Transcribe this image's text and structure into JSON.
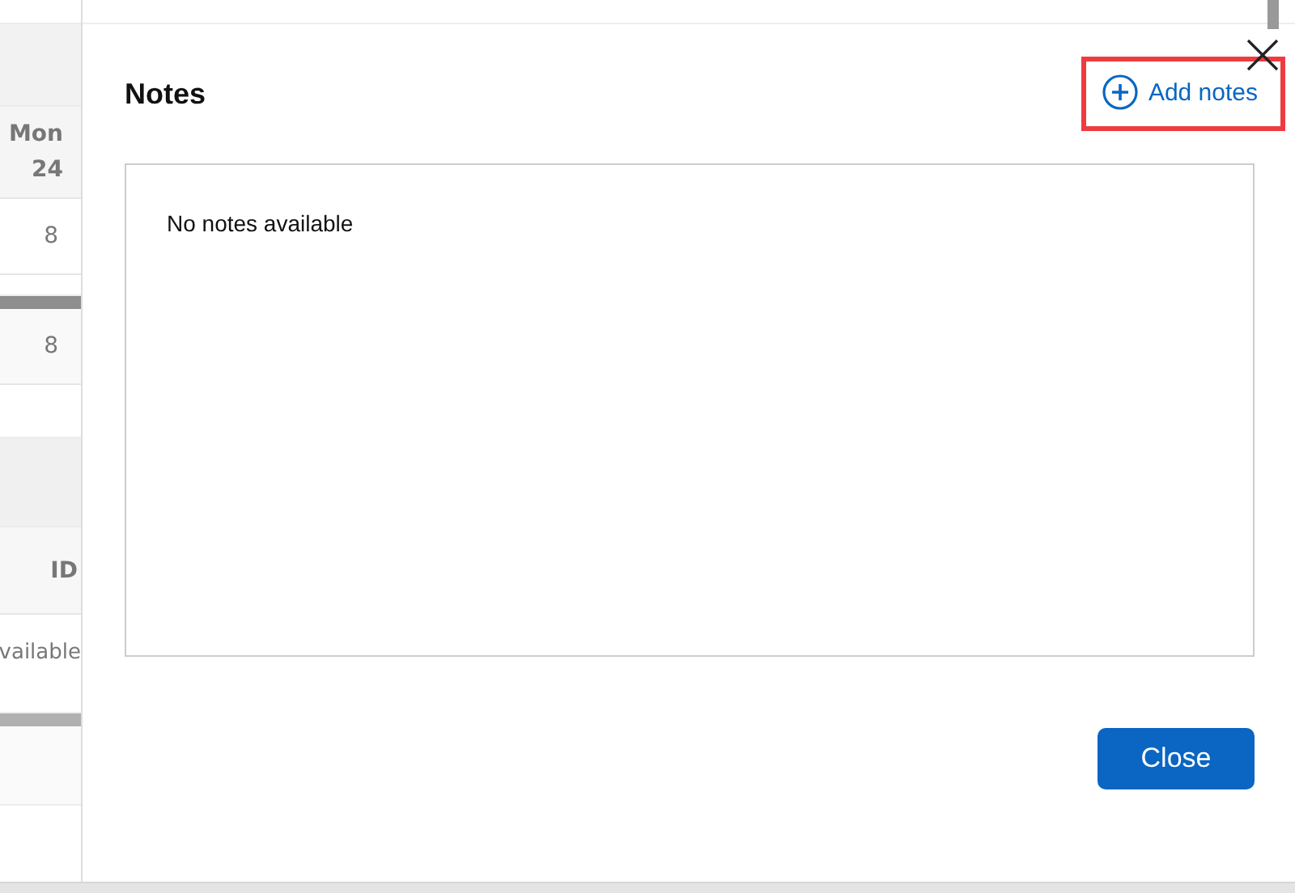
{
  "background": {
    "day_header": {
      "day": "Mon",
      "date": "24"
    },
    "hours": [
      "8",
      "8"
    ],
    "second_table": {
      "column_header": "ID",
      "cell": "vailable"
    }
  },
  "dialog": {
    "title": "Notes",
    "add_button": {
      "label": "Add notes",
      "highlighted": true
    },
    "empty_message": "No notes available",
    "close_button": "Close"
  }
}
